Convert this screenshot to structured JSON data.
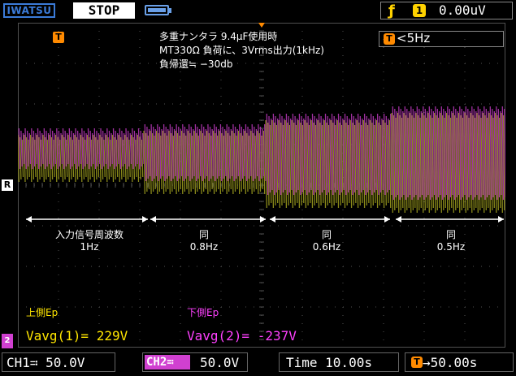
{
  "header": {
    "brand": "IWATSU",
    "status": "STOP",
    "trigger_edge_icon": "rising-edge-icon",
    "trigger_source": "1",
    "trigger_level": "0.00uV"
  },
  "annotation": {
    "line1": "多重ナンタラ 9.4μF使用時",
    "line2": "MT330Ω 負荷に、3Vrms出力(1kHz)",
    "line3": "負帰還≒ −30db"
  },
  "filter": {
    "label": "<5Hz"
  },
  "markers": {
    "trigger_position": "T",
    "reference": "R",
    "ch2_marker": "2"
  },
  "segments": [
    {
      "label": "入力信号周波数",
      "sub": "1Hz"
    },
    {
      "label": "同",
      "sub": "0.8Hz"
    },
    {
      "label": "同",
      "sub": "0.6Hz"
    },
    {
      "label": "同",
      "sub": "0.5Hz"
    }
  ],
  "measurements": {
    "upper_title": "上側Ep",
    "lower_title": "下側Ep",
    "upper_value": "Vavg(1)= 229V",
    "lower_value": "Vavg(2)= -237V"
  },
  "footer": {
    "ch1": "CH1≕ 50.0V",
    "ch2_tag": "CH2≕",
    "ch2_scale": "50.0V",
    "timebase": "Time 10.00s",
    "delay_icon": "T",
    "delay": "→50.00s"
  },
  "colors": {
    "ch1": "#8a8a1a",
    "ch2": "#a030a0",
    "grid": "#505050",
    "accent": "#ff8a00"
  }
}
